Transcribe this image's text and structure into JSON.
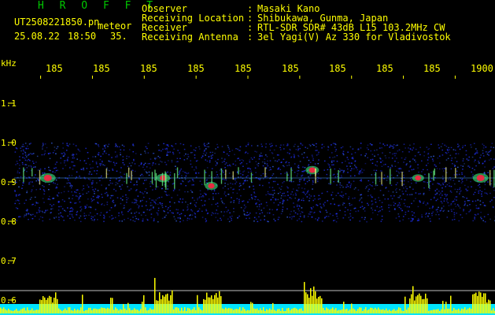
{
  "app": {
    "title": "H R O F F T"
  },
  "file": {
    "name": "UT2508221850.pn",
    "date": "25.08.22",
    "time": "18:50",
    "mode": "meteor",
    "count": "35."
  },
  "info": {
    "labels": [
      "Observer",
      "Receiving Location",
      "Receiver",
      "Receiving Antenna"
    ],
    "colons": [
      ":",
      ":",
      ":",
      ":"
    ],
    "values": [
      "Masaki Kano",
      "Shibukawa, Gunma, Japan",
      "RTL-SDR SDR# 43dB L15 103.2MHz CW",
      "3el Yagi(V) Az 330 for Vladivostok"
    ]
  },
  "chart_data": {
    "type": "heatmap",
    "xlabel": "",
    "ylabel": "kHz",
    "x_ticks": [
      "185",
      "185",
      "185",
      "185",
      "185",
      "185",
      "185",
      "185",
      "185",
      "1900"
    ],
    "y_ticks": [
      "1.1",
      "1.0",
      "0.9",
      "0.8",
      "0.7",
      "0.6"
    ],
    "ylim": [
      0.6,
      1.1
    ],
    "noise_band_khz": [
      0.8,
      1.0
    ],
    "carrier_khz": 0.91,
    "events": [
      {
        "x_index": 0.07,
        "freq_khz": 0.91,
        "strength": 1.0
      },
      {
        "x_index": 0.31,
        "freq_khz": 0.91,
        "strength": 0.8
      },
      {
        "x_index": 0.41,
        "freq_khz": 0.89,
        "strength": 0.7
      },
      {
        "x_index": 0.62,
        "freq_khz": 0.93,
        "strength": 0.75
      },
      {
        "x_index": 0.84,
        "freq_khz": 0.91,
        "strength": 0.6
      },
      {
        "x_index": 0.97,
        "freq_khz": 0.91,
        "strength": 1.0
      }
    ],
    "colors": {
      "noise": "#2233ff",
      "strong": "#ff2040",
      "medium": "#44ff88",
      "ticks": "#ffff00",
      "bar": "#ffff00",
      "baseline": "#00e5ff"
    }
  }
}
